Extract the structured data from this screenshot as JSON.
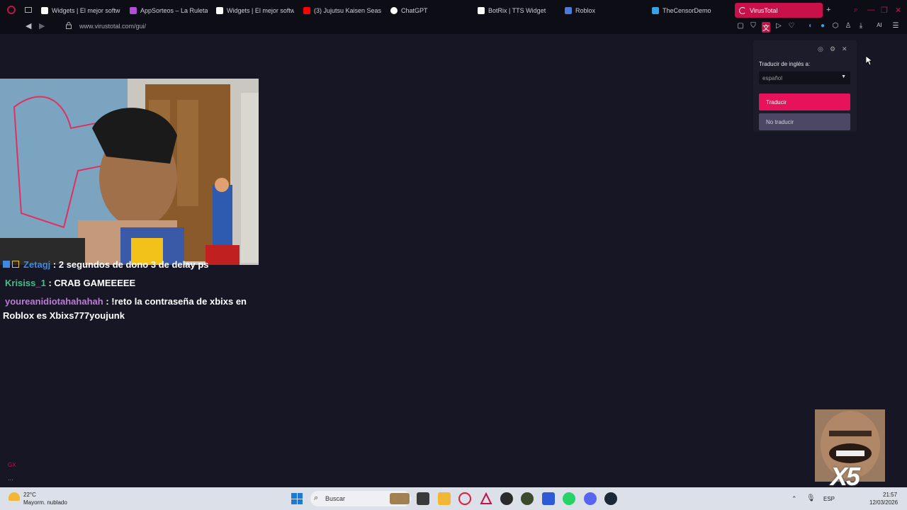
{
  "tabs": [
    {
      "label": "Widgets | El mejor softw",
      "color": "#ffffff"
    },
    {
      "label": "AppSorteos – La Ruleta o",
      "color": "#b04fd6"
    },
    {
      "label": "Widgets | El mejor softw",
      "color": "#ffffff"
    },
    {
      "label": "(3) Jujutsu Kaisen Seaso",
      "color": "#ff0000"
    },
    {
      "label": "ChatGPT",
      "color": "#ffffff"
    },
    {
      "label": "BotRix | TTS Widget",
      "color": "#ffffff"
    },
    {
      "label": "Roblox",
      "color": "#4a7bd8"
    },
    {
      "label": "TheCensorDemo",
      "color": "#3aa0e8"
    },
    {
      "label": "VirusTotal",
      "color": "#ffffff"
    }
  ],
  "address": {
    "url": "www.virustotal.com/gui/"
  },
  "icons": {
    "back": "◀",
    "forward": "▶",
    "spinner": "✕",
    "new_tab": "+",
    "search": "⌕",
    "minimize": "—",
    "restore": "❐",
    "close": "✕",
    "settings": "⚙",
    "menu": "☰",
    "download": "⤓",
    "ai": "AI"
  },
  "chat": [
    {
      "user": "Zetagj",
      "text": " : 2 segundos de dono 3 de delay ps",
      "user_color": "#3d8ae0"
    },
    {
      "user": "Krisiss_1",
      "text": " : CRAB GAMEEEEE",
      "user_color": "#3ec28a"
    },
    {
      "user": "youreanidiotahahahah",
      "text": " : !reto la contraseña de xbixs en",
      "user_color": "#c07ad8"
    },
    {
      "user": "",
      "text": "Roblox es Xbixs777youjunk",
      "user_color": "#ffffff"
    }
  ],
  "translate_popup": {
    "label": "Traducir de inglés a:",
    "selected_language": "español",
    "primary_button": "Traducir",
    "secondary_button": "No traducir"
  },
  "meme": {
    "overlay_text": "X5"
  },
  "taskbar": {
    "weather_temp": "22°C",
    "weather_desc": "Mayorm. nublado",
    "search_placeholder": "Buscar",
    "language": "ESP",
    "time": "21:57",
    "date": "12/03/2026"
  },
  "sidebar": {
    "gx_label": "GX",
    "more": "···"
  },
  "colors": {
    "accent": "#c8104a",
    "primary_button": "#e8125a",
    "secondary_button": "#4b4764"
  }
}
